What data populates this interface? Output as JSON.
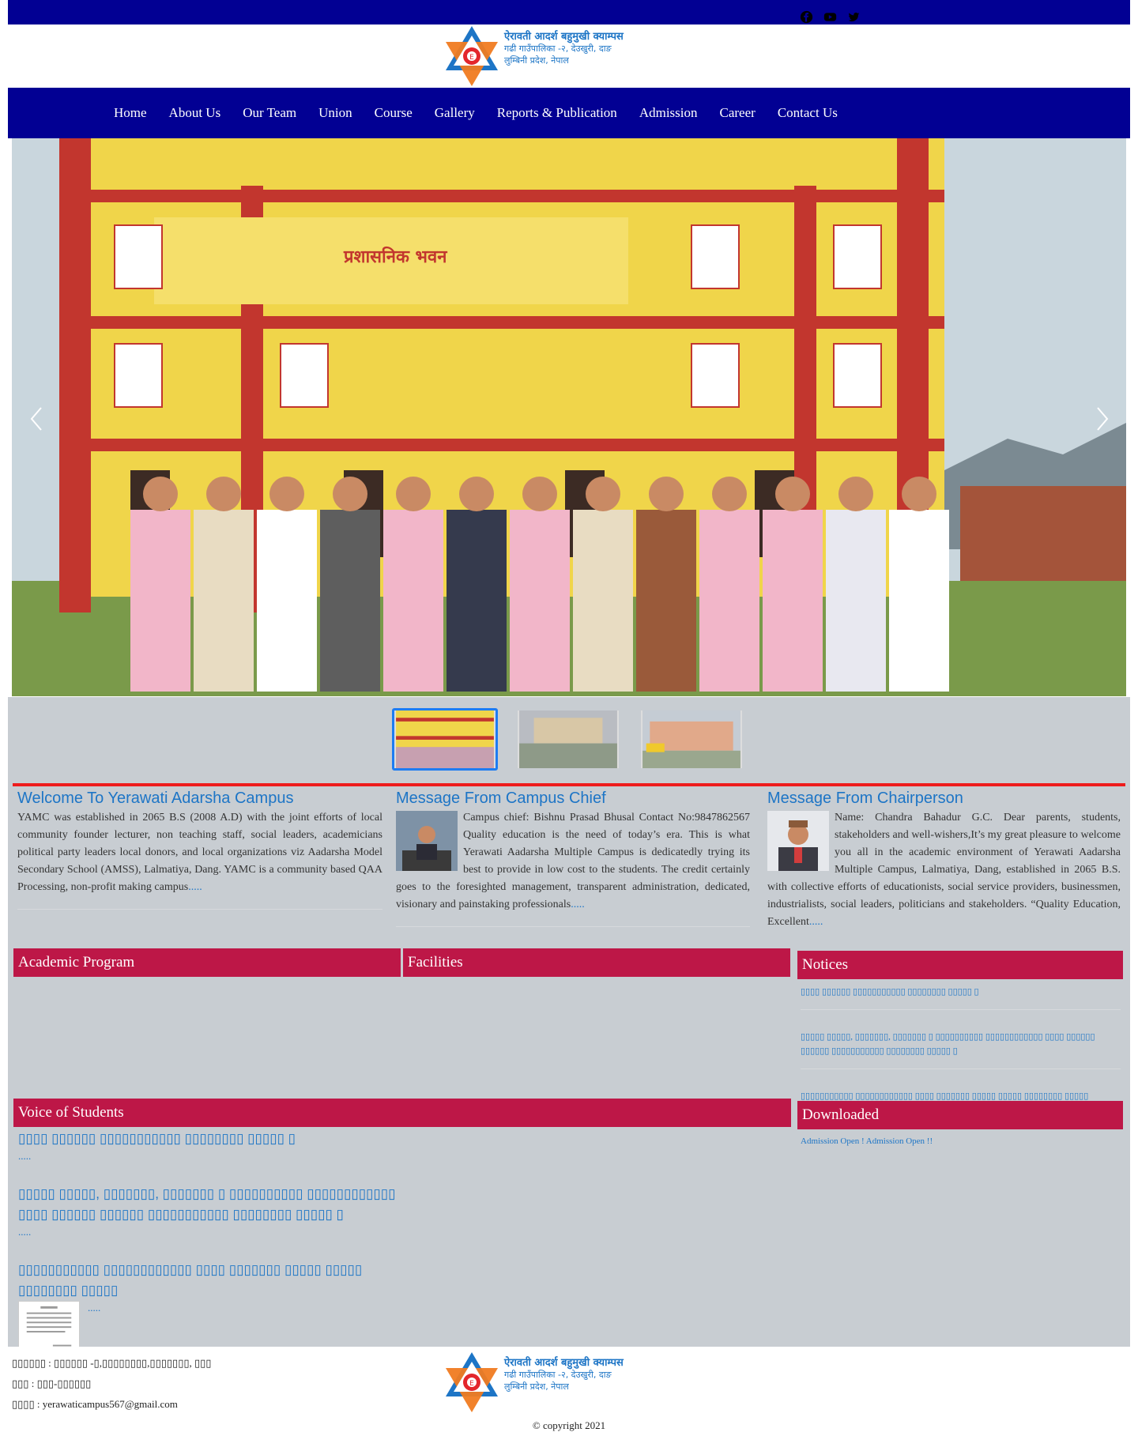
{
  "header": {
    "logo_line1": "ऐरावती आदर्श बहुमुखी क्याम्पस",
    "logo_line2": "गढी गाउँपालिका -२, देउखुरी, दाङ",
    "logo_line3": "लुम्बिनी प्रदेश, नेपाल"
  },
  "social": [
    "facebook-icon",
    "youtube-icon",
    "twitter-icon"
  ],
  "nav": {
    "items": [
      {
        "label": "Home"
      },
      {
        "label": "About Us"
      },
      {
        "label": "Our Team"
      },
      {
        "label": "Union"
      },
      {
        "label": "Course"
      },
      {
        "label": "Gallery"
      },
      {
        "label": "Reports & Publication"
      },
      {
        "label": "Admission"
      },
      {
        "label": "Career"
      },
      {
        "label": "Contact Us"
      }
    ]
  },
  "hero": {
    "building_sign": "प्रशासनिक भवन"
  },
  "welcome": {
    "title": "Welcome To Yerawati Adarsha Campus",
    "body": "YAMC was established in 2065 B.S (2008 A.D) with the joint efforts of local community founder lecturer, non teaching staff, social leaders, academicians political party leaders local donors, and local organizations viz Aadarsha Model Secondary School  (AMSS), Lalmatiya, Dang.   YAMC is a community based QAA Processing, non-profit making campus",
    "more": "....."
  },
  "chief": {
    "title": "Message From Campus Chief",
    "body": "Campus chief: Bishnu Prasad Bhusal Contact No:9847862567 Quality education is the need of today’s era. This is what Yerawati Aadarsha Multiple Campus is dedicatedly trying its best to provide in low cost to the students. The credit certainly goes to the foresighted management, transparent administration, dedicated, visionary and painstaking professionals",
    "more": "....."
  },
  "chair": {
    "title": "Message From Chairperson",
    "body": "Name: Chandra Bahadur G.C. Dear parents, students, stakeholders and well-wishers,It’s my great pleasure to welcome you all in the academic environment of Yerawati Aadarsha Multiple Campus, Lalmatiya, Dang, established in 2065 B.S. with collective efforts of educationists, social service providers, businessmen, industrialists, social leaders, politicians and stakeholders. “Quality Education, Excellent",
    "more": "....."
  },
  "panels": {
    "academic": "Academic Program",
    "facilities": "Facilities",
    "notices": "Notices",
    "voice": "Voice of Students",
    "downloaded": "Downloaded"
  },
  "notices": [
    "▯▯▯▯ ▯▯▯▯▯▯ ▯▯▯▯▯▯▯▯▯▯▯ ▯▯▯▯▯▯▯▯ ▯▯▯▯▯ ▯",
    "▯▯▯▯▯ ▯▯▯▯▯, ▯▯▯▯▯▯▯, ▯▯▯▯▯▯▯ ▯ ▯▯▯▯▯▯▯▯▯▯ ▯▯▯▯▯▯▯▯▯▯▯▯ ▯▯▯▯ ▯▯▯▯▯▯ ▯▯▯▯▯▯ ▯▯▯▯▯▯▯▯▯▯▯ ▯▯▯▯▯▯▯▯ ▯▯▯▯▯ ▯",
    "▯▯▯▯▯▯▯▯▯▯▯ ▯▯▯▯▯▯▯▯▯▯▯▯ ▯▯▯▯ ▯▯▯▯▯▯▯ ▯▯▯▯▯ ▯▯▯▯▯ ▯▯▯▯▯▯▯▯ ▯▯▯▯▯",
    "Admission Open ! Admission Open !!"
  ],
  "voices": [
    {
      "title": "▯▯▯▯ ▯▯▯▯▯▯ ▯▯▯▯▯▯▯▯▯▯▯ ▯▯▯▯▯▯▯▯ ▯▯▯▯▯ ▯",
      "more": "....."
    },
    {
      "title": "▯▯▯▯▯ ▯▯▯▯▯, ▯▯▯▯▯▯▯, ▯▯▯▯▯▯▯ ▯ ▯▯▯▯▯▯▯▯▯▯ ▯▯▯▯▯▯▯▯▯▯▯▯ ▯▯▯▯ ▯▯▯▯▯▯ ▯▯▯▯▯▯ ▯▯▯▯▯▯▯▯▯▯▯ ▯▯▯▯▯▯▯▯ ▯▯▯▯▯ ▯",
      "more": "....."
    },
    {
      "title": "▯▯▯▯▯▯▯▯▯▯▯ ▯▯▯▯▯▯▯▯▯▯▯▯ ▯▯▯▯ ▯▯▯▯▯▯▯ ▯▯▯▯▯ ▯▯▯▯▯ ▯▯▯▯▯▯▯▯ ▯▯▯▯▯",
      "more": "....."
    }
  ],
  "footer": {
    "address": "▯▯▯▯▯▯ : ▯▯▯▯▯▯ -▯,▯▯▯▯▯▯▯▯,▯▯▯▯▯▯▯, ▯▯▯",
    "phone": "▯▯▯ : ▯▯▯-▯▯▯▯▯▯",
    "email": "▯▯▯▯ : yerawaticampus567@gmail.com",
    "copyright": "© copyright 2021"
  },
  "colors": {
    "nav_blue": "#020093",
    "accent_red": "#bd1747",
    "link_blue": "#1d75c6",
    "divider_red": "#ee1c1c",
    "body_gray": "#c8cdd2"
  }
}
